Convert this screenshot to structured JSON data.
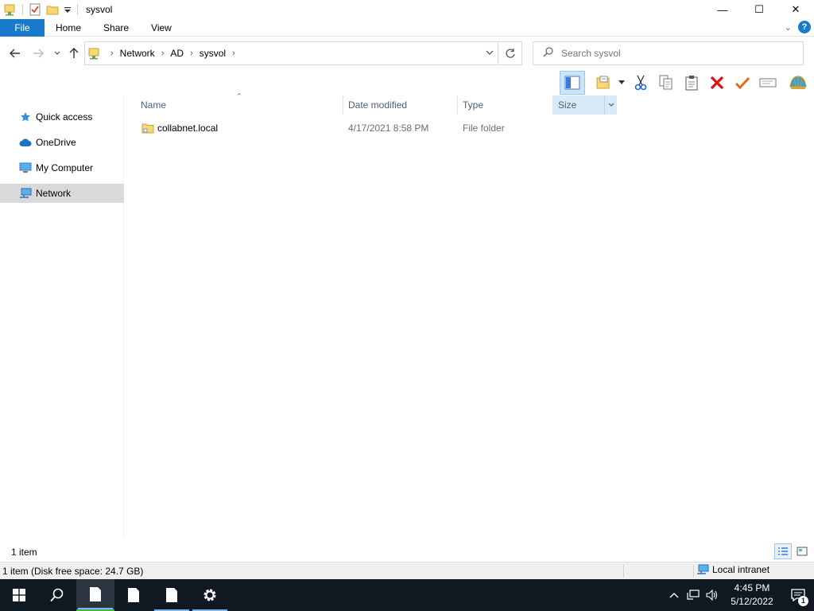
{
  "window": {
    "title": "sysvol"
  },
  "window_controls": {
    "minimize": "—",
    "maximize": "☐",
    "close": "✕"
  },
  "ribbon": {
    "tabs": [
      "File",
      "Home",
      "Share",
      "View"
    ],
    "help_label": "?"
  },
  "address": {
    "breadcrumbs": [
      "Network",
      "AD",
      "sysvol"
    ],
    "search_placeholder": "Search sysvol"
  },
  "navigation": {
    "items": [
      {
        "label": "Quick access",
        "icon": "star-icon"
      },
      {
        "label": "OneDrive",
        "icon": "cloud-icon"
      },
      {
        "label": "My Computer",
        "icon": "computer-icon"
      },
      {
        "label": "Network",
        "icon": "network-icon",
        "selected": true
      }
    ]
  },
  "file_list": {
    "columns": [
      "Name",
      "Date modified",
      "Type",
      "Size"
    ],
    "rows": [
      {
        "name": "collabnet.local",
        "date_modified": "4/17/2021 8:58 PM",
        "type": "File folder",
        "size": ""
      }
    ]
  },
  "status": {
    "item_count": "1 item",
    "disk_info": "1 item (Disk free space: 24.7 GB)",
    "zone": "Local intranet"
  },
  "taskbar": {
    "time": "4:45 PM",
    "date": "5/12/2022",
    "notification_count": "1"
  },
  "colors": {
    "accent": "#1979ca",
    "selection": "#cce4f7",
    "taskbar": "#101821",
    "header_text": "#4c607a"
  }
}
